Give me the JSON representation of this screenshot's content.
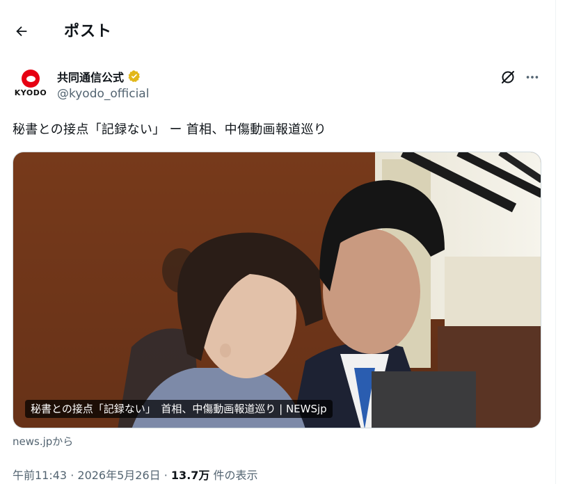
{
  "header": {
    "back_icon": "arrow-left-icon",
    "title": "ポスト"
  },
  "author": {
    "avatar_label": "KYODO",
    "name": "共同通信公式",
    "handle": "@kyodo_official",
    "verified_icon": "verified-badge-icon",
    "verified_color": "#e2b719",
    "brand_color": "#e60012"
  },
  "actions": {
    "grok_icon": "grok-icon",
    "more_icon": "more-dots-icon"
  },
  "post": {
    "text": "秘書との接点「記録ない」 ー 首相、中傷動画報道巡り"
  },
  "card": {
    "overlay_title": "秘書との接点「記録ない」　首相、中傷動画報道巡り | NEWSjp",
    "source": "news.jpから"
  },
  "meta": {
    "time": "午前11:43",
    "separator": " · ",
    "date": "2026年5月26日",
    "views_count": "13.7万",
    "views_label": "件の表示"
  },
  "colors": {
    "text_primary": "#0f1419",
    "text_secondary": "#536471",
    "border": "#cfd9de"
  }
}
